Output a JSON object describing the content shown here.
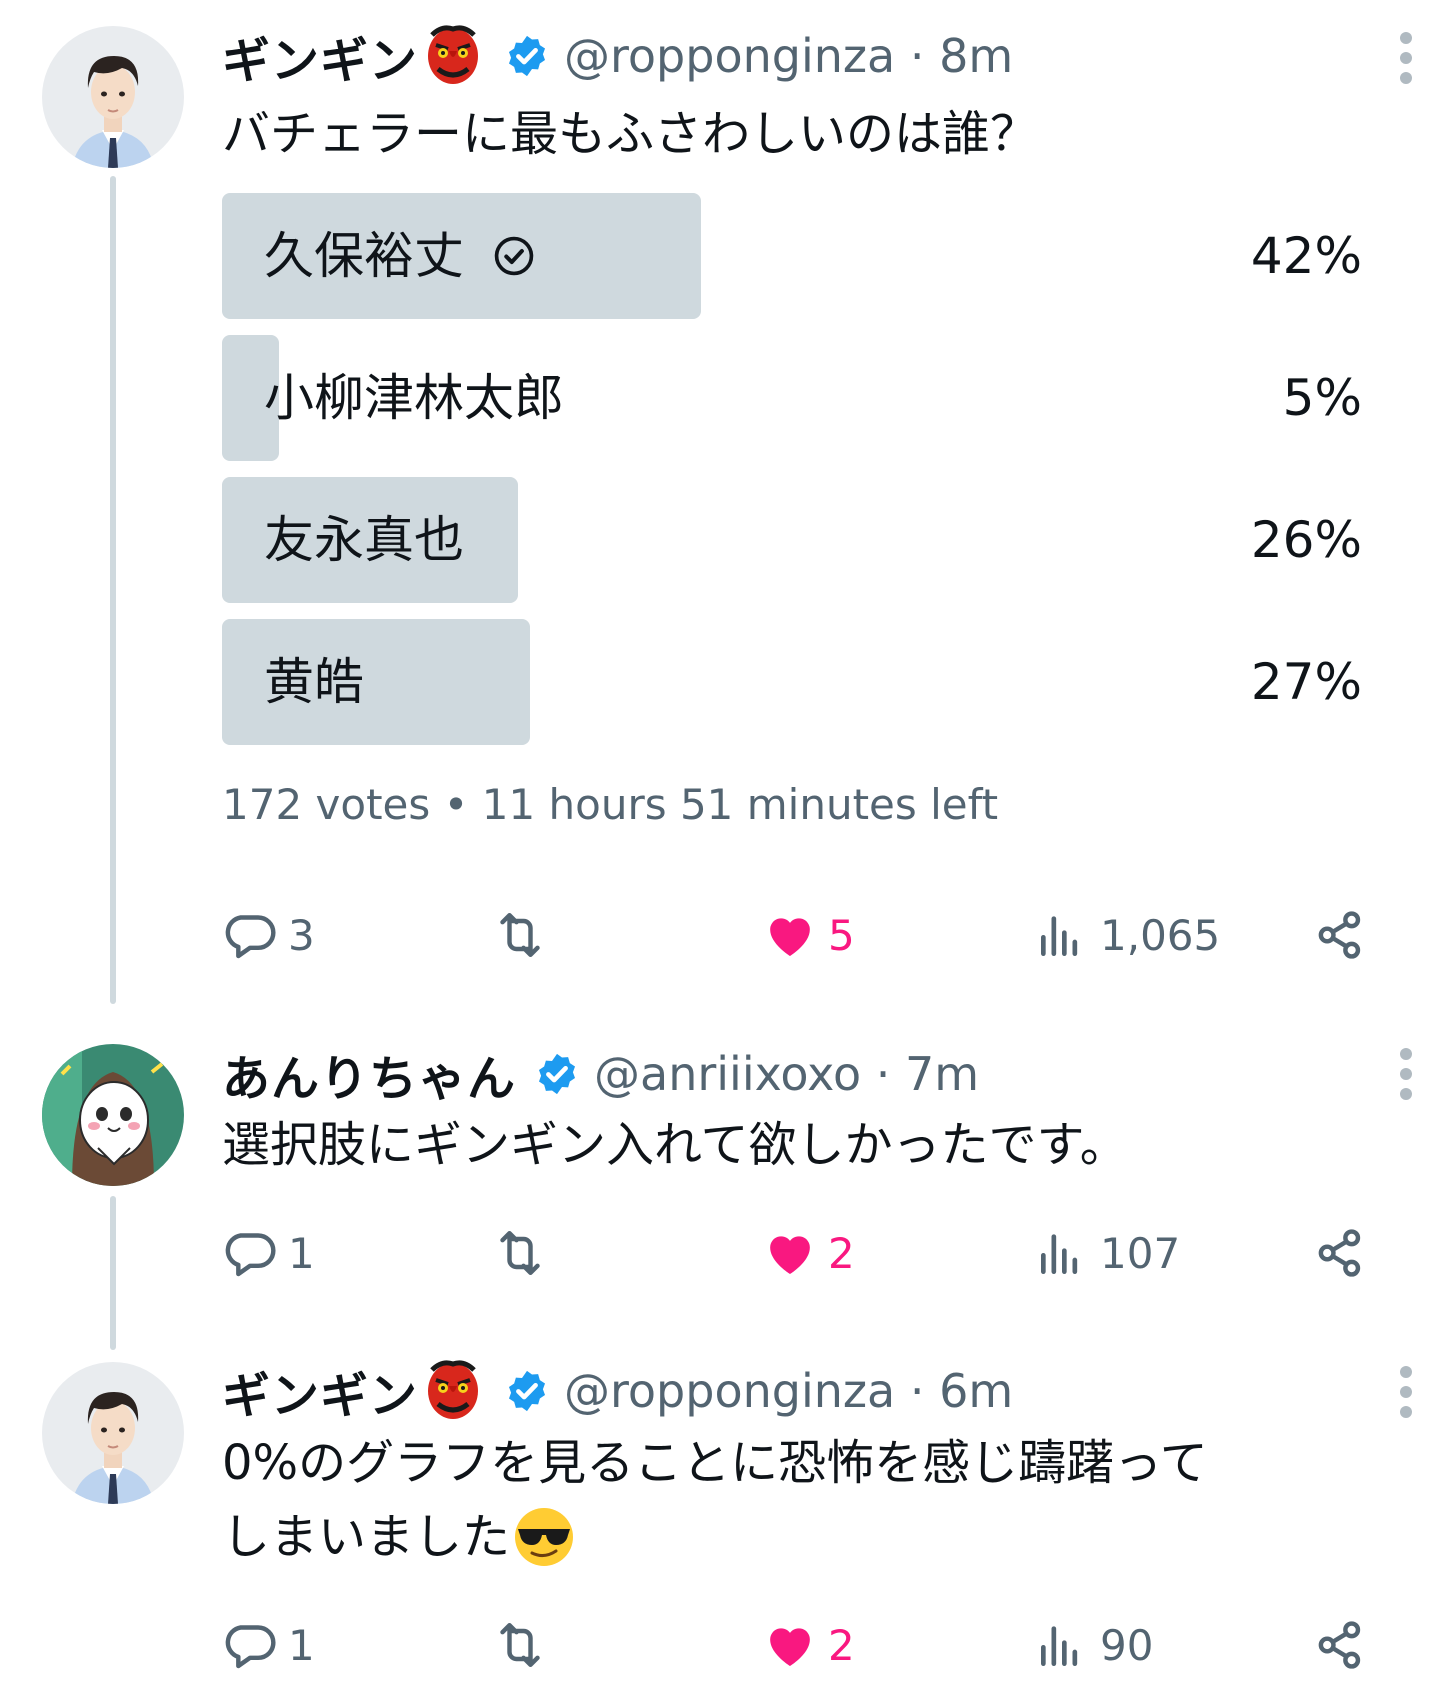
{
  "tweets": [
    {
      "name": "ギンギン",
      "handle": "@ropponginza · 8m",
      "text": "バチェラーに最もふさわしいのは誰？",
      "poll": {
        "options": [
          {
            "label": "久保裕丈",
            "percent_text": "42%",
            "percent": 42,
            "chosen": true
          },
          {
            "label": "小柳津林太郎",
            "percent_text": "5%",
            "percent": 5,
            "chosen": false
          },
          {
            "label": "友永真也",
            "percent_text": "26%",
            "percent": 26,
            "chosen": false
          },
          {
            "label": "黄皓",
            "percent_text": "27%",
            "percent": 27,
            "chosen": false
          }
        ],
        "meta": "172 votes • 11 hours 51 minutes left"
      },
      "replies": "3",
      "likes": "5",
      "views": "1,065"
    },
    {
      "name": "あんりちゃん",
      "handle": "@anriiixoxo · 7m",
      "text": "選択肢にギンギン入れて欲しかったです。",
      "replies": "1",
      "likes": "2",
      "views": "107"
    },
    {
      "name": "ギンギン",
      "handle": "@ropponginza · 6m",
      "text_line1": "0%のグラフを見ることに恐怖を感じ躊躇って",
      "text_line2": "しまいました",
      "replies": "1",
      "likes": "2",
      "views": "90"
    }
  ],
  "icons": {
    "name_emoji": "tengu-mask-emoji",
    "verified": "verified-badge-icon",
    "reply": "reply-icon",
    "retweet": "retweet-icon",
    "like": "heart-icon",
    "views": "views-icon",
    "share": "share-icon",
    "more": "more-icon",
    "text_emoji": "sunglasses-emoji"
  },
  "colors": {
    "text": "#0f1419",
    "muted": "#536471",
    "poll_bar": "#cfd9de",
    "verified": "#1d9bf0",
    "like": "#f91880"
  }
}
